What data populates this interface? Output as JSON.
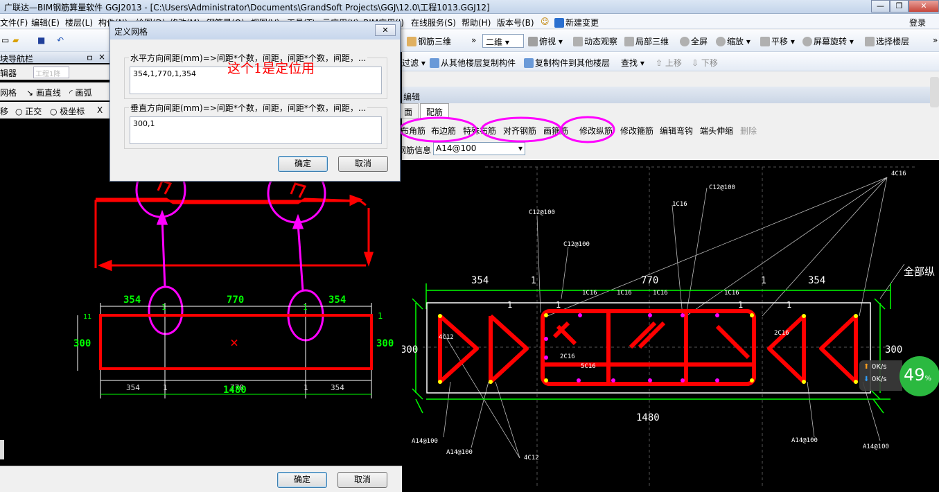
{
  "window": {
    "title": "广联达—BIM钢筋算量软件 GGJ2013 - [C:\\Users\\Administrator\\Documents\\GrandSoft Projects\\GGJ\\12.0\\工程1013.GGJ12]"
  },
  "menu": {
    "items": [
      "文件(F)",
      "编辑(E)",
      "楼层(L)",
      "构件(N)",
      "绘图(D)",
      "修改(M)",
      "钢筋量(Q)",
      "视图(V)",
      "工具(T)",
      "云应用(Y)",
      "BIM应用(I)",
      "在线服务(S)",
      "帮助(H)",
      "版本号(B)",
      "新建变更"
    ],
    "login": "登录"
  },
  "toolbar1": {
    "rebar3d": "钢筋三维",
    "view2d": "二维",
    "top_view": "俯视",
    "dynamic_view": "动态观察",
    "local3d": "局部三维",
    "fullscreen": "全屏",
    "zoom": "缩放",
    "pan": "平移",
    "rotate": "屏幕旋转",
    "select_floor": "选择楼层"
  },
  "toolbar2": {
    "filter": "过滤",
    "copy_from": "从其他楼层复制构件",
    "copy_to": "复制构件到其他楼层",
    "find": "查找",
    "move_up": "上移",
    "move_down": "下移"
  },
  "left_panel": {
    "nav_title": "块导航栏",
    "pin": "ㅁ",
    "close": "×",
    "editor": "辑器",
    "tab": "工程1降",
    "grid": "网格",
    "draw_line": "画直线",
    "draw_arc": "画弧",
    "move": "移",
    "ortho": "正交",
    "polar": "极坐标",
    "x": "X"
  },
  "section_left": {
    "top_dims": [
      "354",
      "770",
      "354"
    ],
    "ones": [
      "1",
      "1"
    ],
    "left_dim": "300",
    "right_dim": "300",
    "bottom_dims": [
      "354",
      "1",
      "770",
      "1",
      "354"
    ],
    "total": "1480",
    "corner": "11",
    "right_one": "1"
  },
  "dialog": {
    "title": "定义网格",
    "horizontal_label": "水平方向间距(mm)=>间距*个数，间距，间距*个数，间距，...",
    "horizontal_value": "354,1,770,1,354",
    "vertical_label": "垂直方向间距(mm)=>间距*个数，间距，间距*个数，间距，...",
    "vertical_value": "300,1",
    "ok": "确定",
    "cancel": "取消"
  },
  "annotation": "这个1是定位用",
  "bottom_buttons": {
    "ok": "确定",
    "cancel": "取消"
  },
  "right_panel": {
    "caption": "编辑",
    "tabs": [
      "面",
      "配筋"
    ],
    "commands": [
      "布角筋",
      "布边筋",
      "特殊布筋",
      "对齐钢筋",
      "画箍筋",
      "修改纵筋",
      "修改箍筋",
      "编辑弯钩",
      "端头伸缩",
      "删除"
    ],
    "info_label": "钢筋信息",
    "info_value": "A14@100"
  },
  "section_right": {
    "top_dims": [
      "354",
      "1",
      "770",
      "1",
      "354"
    ],
    "inner_ones": [
      "1",
      "1",
      "1",
      "1"
    ],
    "left_dim": "300",
    "right_dim": "300",
    "total": "1480",
    "all_long_label": "全部纵",
    "labels": [
      "4C16",
      "C12@100",
      "1C16",
      "C12@100",
      "C12@100",
      "1C16",
      "1C16",
      "1C16",
      "1C16",
      "4C12",
      "2C16",
      "2C16",
      "5C16",
      "A14@100",
      "A14@100",
      "A14@100",
      "A14@100",
      "4C12"
    ]
  },
  "net": {
    "up": "0K/s",
    "down": "0K/s",
    "percent": "49",
    "percent_sign": "%"
  },
  "colors": {
    "accent": "#ff00ff",
    "rebar": "#ff0000",
    "dim": "#00ff00",
    "dialog_bg": "#f0f0f0"
  }
}
